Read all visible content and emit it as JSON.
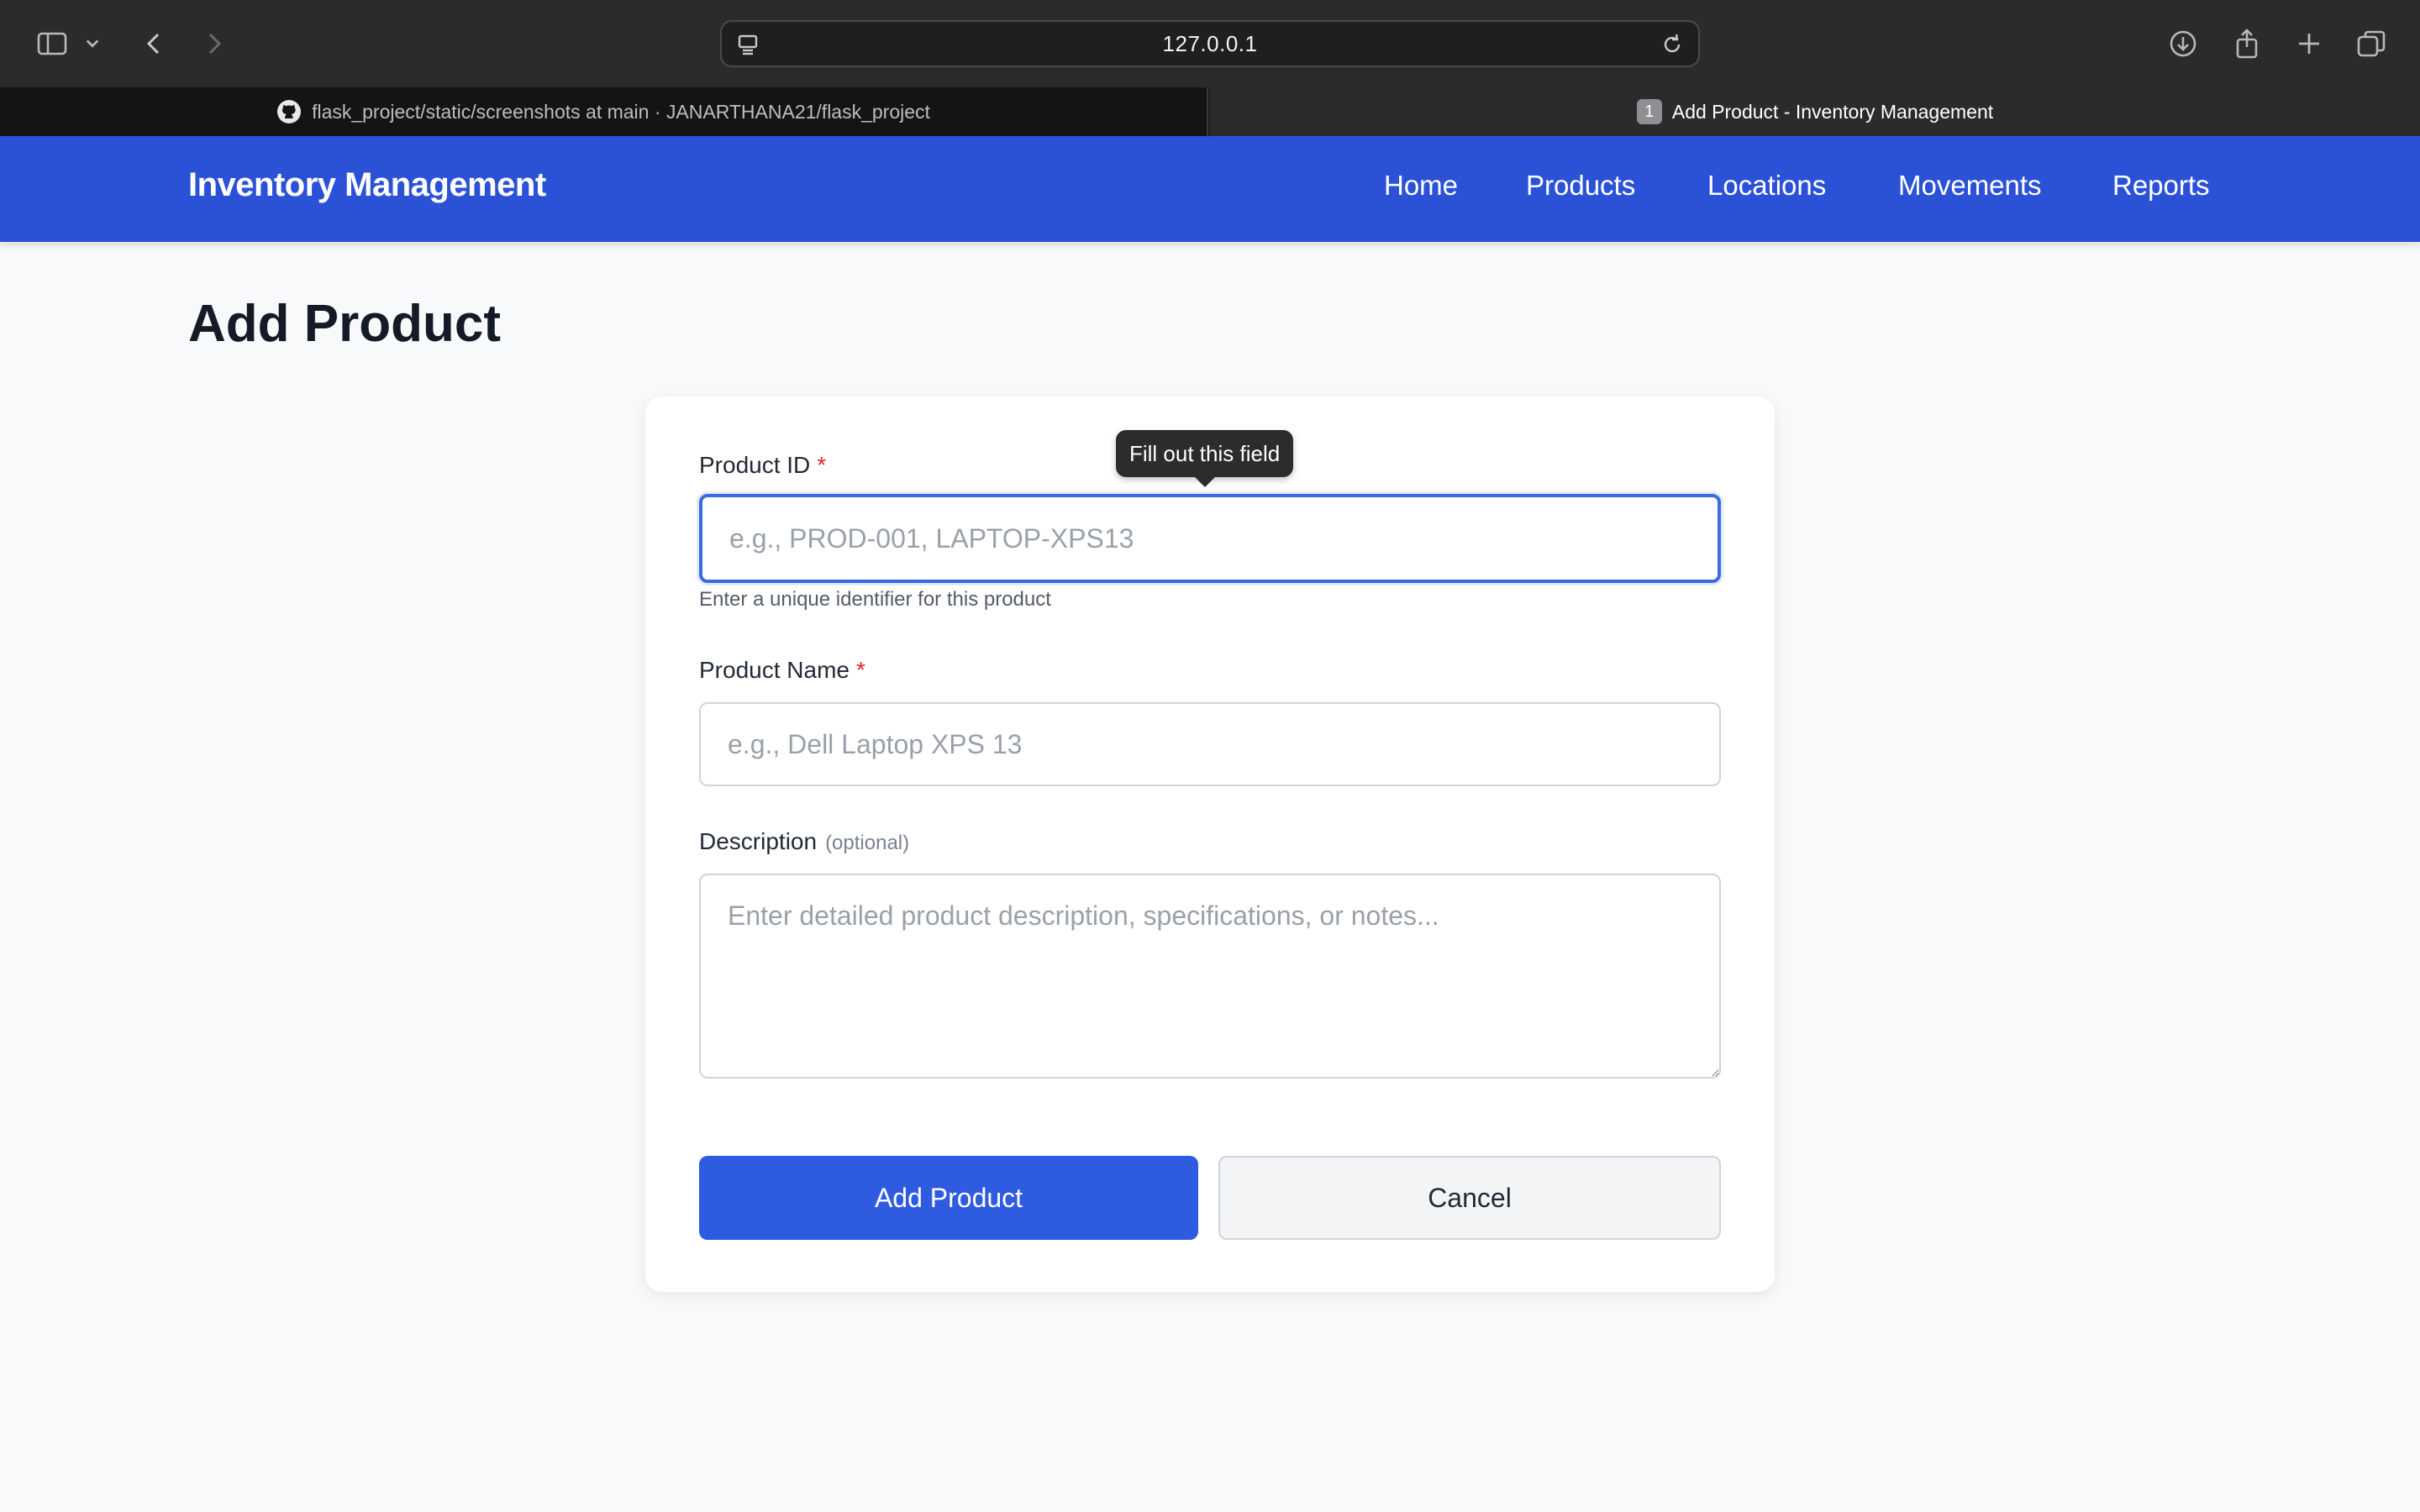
{
  "browser": {
    "url": "127.0.0.1",
    "tabs": [
      {
        "title": "flask_project/static/screenshots at main · JANARTHANA21/flask_project",
        "active": false
      },
      {
        "title": "Add Product - Inventory Management",
        "badge": "1",
        "active": true
      }
    ],
    "icons": [
      "sidebar-icon",
      "chevron-down-icon",
      "back-icon",
      "forward-icon",
      "page-menu-icon",
      "reload-icon",
      "download-icon",
      "share-icon",
      "new-tab-icon",
      "tab-overview-icon"
    ]
  },
  "navbar": {
    "brand": "Inventory Management",
    "links": [
      "Home",
      "Products",
      "Locations",
      "Movements",
      "Reports"
    ],
    "color": "#2b52d6"
  },
  "page": {
    "title": "Add Product"
  },
  "form": {
    "product_id": {
      "label": "Product ID",
      "required_mark": "*",
      "placeholder": "e.g., PROD-001, LAPTOP-XPS13",
      "value": "",
      "hint": "Enter a unique identifier for this product",
      "tooltip": "Fill out this field"
    },
    "product_name": {
      "label": "Product Name",
      "required_mark": "*",
      "placeholder": "e.g., Dell Laptop XPS 13",
      "value": ""
    },
    "description": {
      "label": "Description",
      "optional_label": "(optional)",
      "placeholder": "Enter detailed product description, specifications, or notes...",
      "value": ""
    },
    "submit_label": "Add Product",
    "cancel_label": "Cancel"
  },
  "colors": {
    "primary_button": "#2f5be0",
    "focus_ring": "#3b6be0",
    "required": "#dc2626"
  }
}
